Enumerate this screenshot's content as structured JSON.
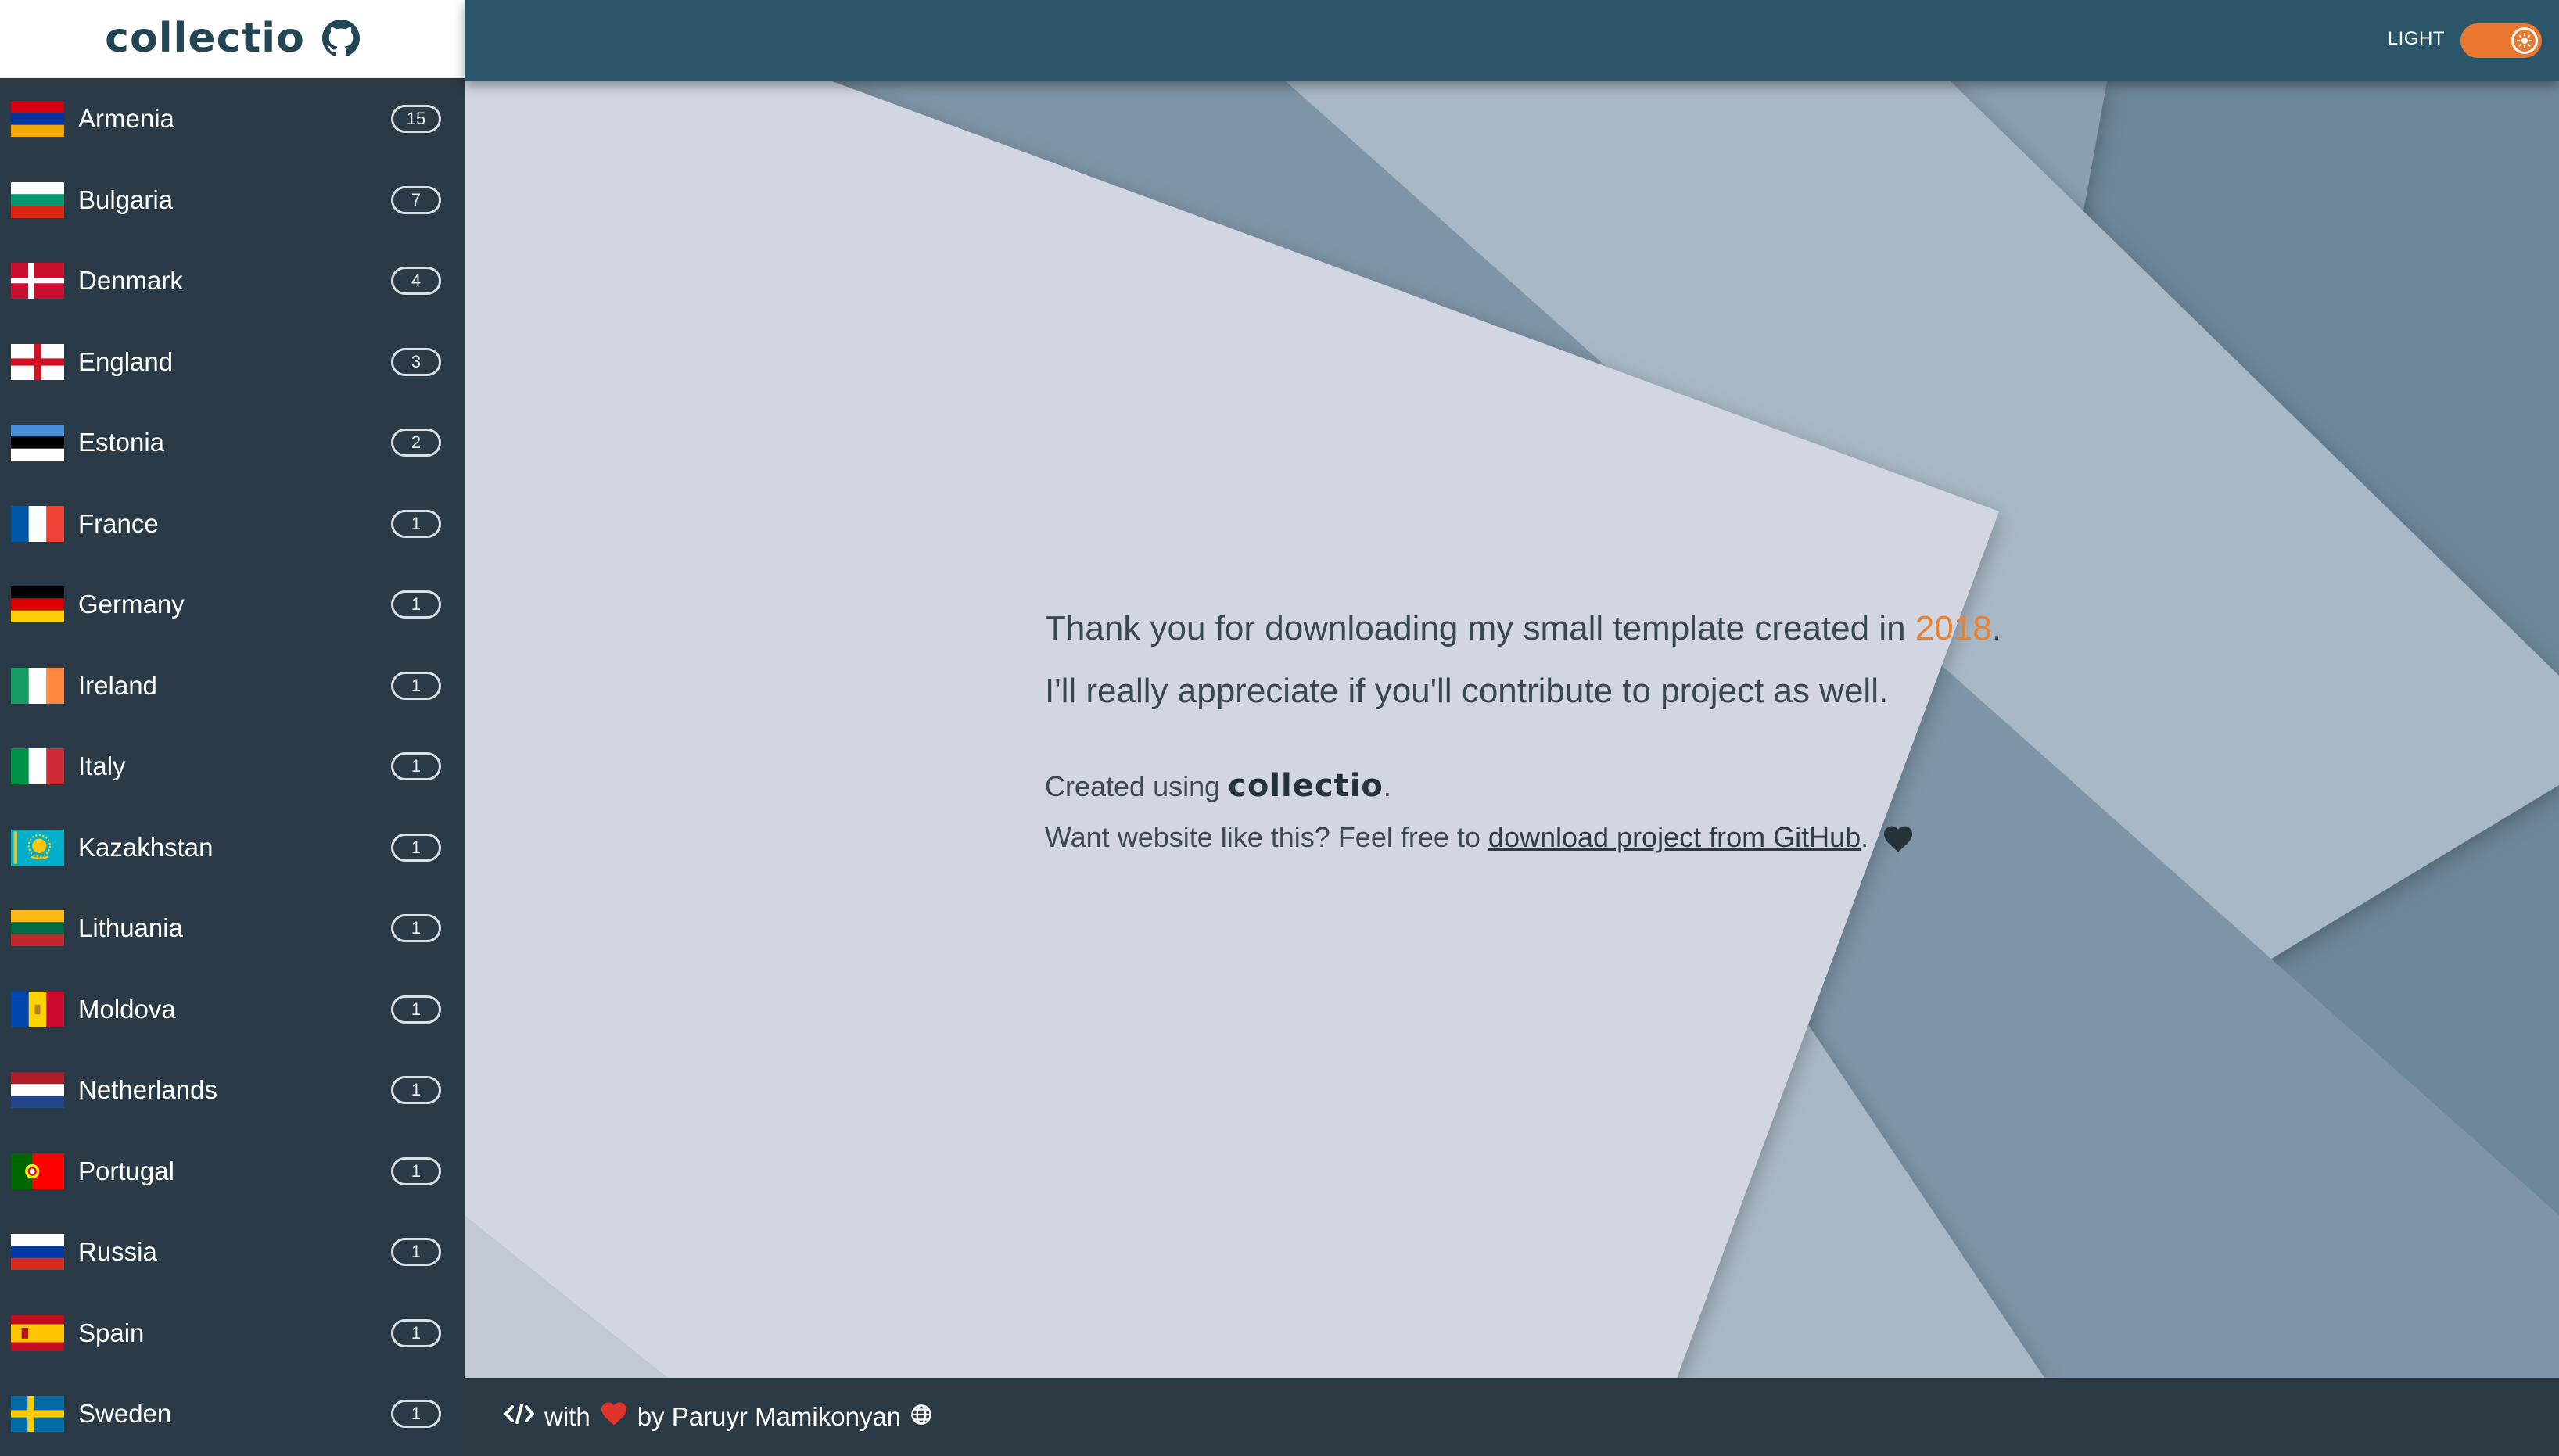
{
  "app": {
    "logo_text": "collectio",
    "logo_icon": "github-icon"
  },
  "topbar": {
    "theme_label": "LIGHT",
    "theme_toggle_icon": "sun-icon",
    "accent_color": "#e9772f"
  },
  "sidebar": {
    "items": [
      {
        "name": "Armenia",
        "count": "15",
        "flag": "armenia-flag"
      },
      {
        "name": "Bulgaria",
        "count": "7",
        "flag": "bulgaria-flag"
      },
      {
        "name": "Denmark",
        "count": "4",
        "flag": "denmark-flag"
      },
      {
        "name": "England",
        "count": "3",
        "flag": "england-flag"
      },
      {
        "name": "Estonia",
        "count": "2",
        "flag": "estonia-flag"
      },
      {
        "name": "France",
        "count": "1",
        "flag": "france-flag"
      },
      {
        "name": "Germany",
        "count": "1",
        "flag": "germany-flag"
      },
      {
        "name": "Ireland",
        "count": "1",
        "flag": "ireland-flag"
      },
      {
        "name": "Italy",
        "count": "1",
        "flag": "italy-flag"
      },
      {
        "name": "Kazakhstan",
        "count": "1",
        "flag": "kazakhstan-flag"
      },
      {
        "name": "Lithuania",
        "count": "1",
        "flag": "lithuania-flag"
      },
      {
        "name": "Moldova",
        "count": "1",
        "flag": "moldova-flag"
      },
      {
        "name": "Netherlands",
        "count": "1",
        "flag": "netherlands-flag"
      },
      {
        "name": "Portugal",
        "count": "1",
        "flag": "portugal-flag"
      },
      {
        "name": "Russia",
        "count": "1",
        "flag": "russia-flag"
      },
      {
        "name": "Spain",
        "count": "1",
        "flag": "spain-flag"
      },
      {
        "name": "Sweden",
        "count": "1",
        "flag": "sweden-flag"
      }
    ]
  },
  "main": {
    "line1_before": "Thank you for downloading my small template created in ",
    "line1_year": "2018",
    "line1_after": ".",
    "line2": "I'll really appreciate if you'll contribute to project as well.",
    "line3_prefix": "Created using ",
    "line3_brand": "collectio",
    "line3_suffix": ".",
    "line4_prefix": "Want website like this? Feel free to ",
    "line4_link": "download project from GitHub",
    "line4_suffix": ".",
    "year_color": "#e9812e"
  },
  "footer": {
    "code_icon": "code-icon",
    "with_text": "with",
    "heart_icon": "heart-icon",
    "by_text": "by Paruyr Mamikonyan",
    "globe_icon": "globe-icon"
  }
}
